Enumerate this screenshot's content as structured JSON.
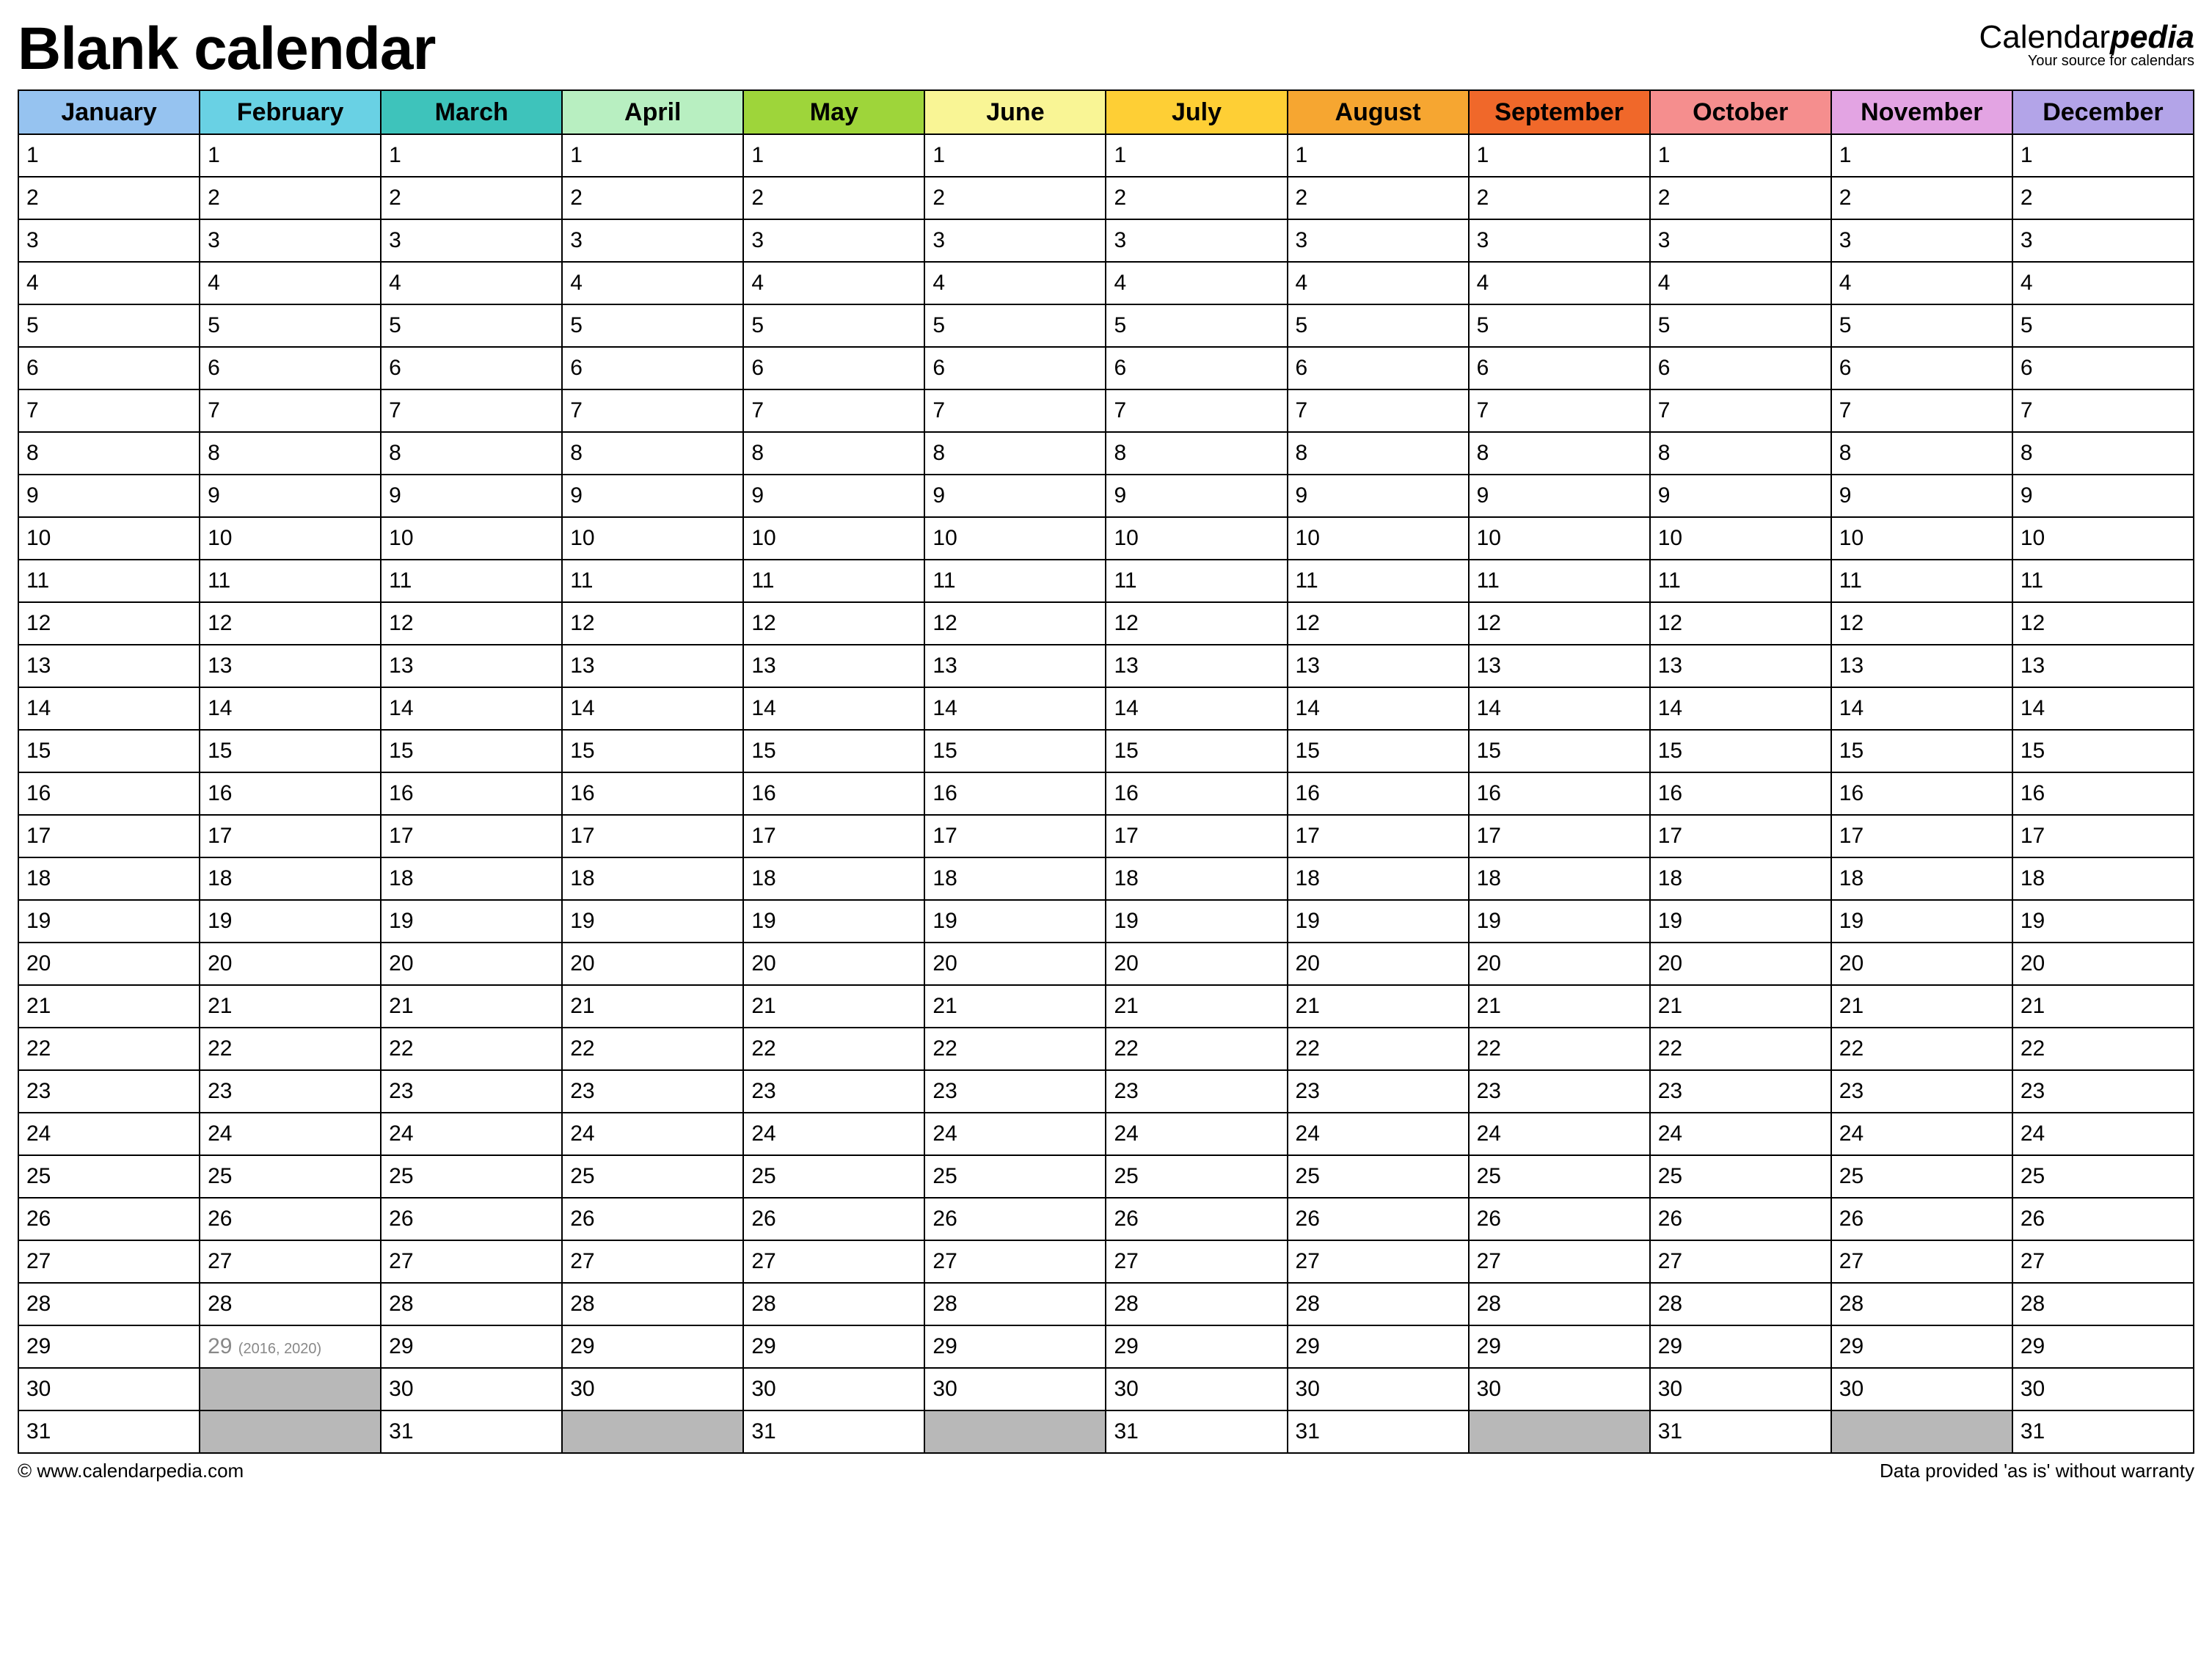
{
  "header": {
    "title": "Blank calendar",
    "brand_prefix": "Calendar",
    "brand_suffix": "pedia",
    "brand_tagline": "Your source for calendars"
  },
  "months": [
    {
      "name": "January",
      "color": "#96c3f0",
      "days": 31
    },
    {
      "name": "February",
      "color": "#69d1e4",
      "days": 29,
      "leap": {
        "day": 29,
        "note": "(2016, 2020)"
      }
    },
    {
      "name": "March",
      "color": "#3ec3bb",
      "days": 31
    },
    {
      "name": "April",
      "color": "#b8efc1",
      "days": 30
    },
    {
      "name": "May",
      "color": "#9ed53a",
      "days": 31
    },
    {
      "name": "June",
      "color": "#f9f595",
      "days": 30
    },
    {
      "name": "July",
      "color": "#fecf35",
      "days": 31
    },
    {
      "name": "August",
      "color": "#f6a631",
      "days": 31
    },
    {
      "name": "September",
      "color": "#f0682a",
      "days": 30
    },
    {
      "name": "October",
      "color": "#f58e8e",
      "days": 31
    },
    {
      "name": "November",
      "color": "#e3a4e3",
      "days": 30
    },
    {
      "name": "December",
      "color": "#b3a4e8",
      "days": 31
    }
  ],
  "max_rows": 31,
  "footer": {
    "left": "© www.calendarpedia.com",
    "right": "Data provided 'as is' without warranty"
  }
}
